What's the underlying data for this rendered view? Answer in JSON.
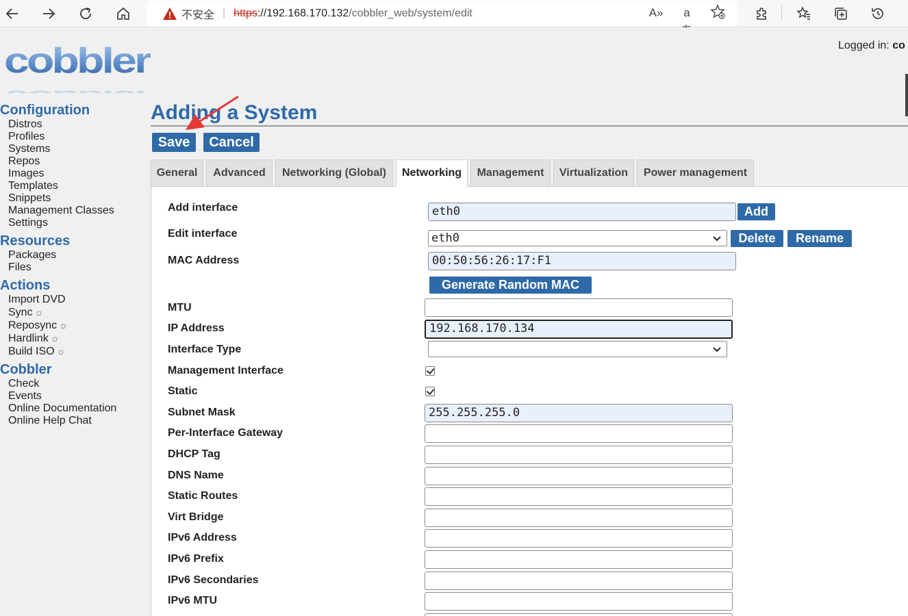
{
  "browser": {
    "security_label": "不安全",
    "url_scheme": "https",
    "url_host": "://192.168.170.132",
    "url_path": "/cobbler_web/system/edit"
  },
  "header": {
    "logged_in_label": "Logged in:",
    "logged_in_user": "co"
  },
  "sidebar": {
    "configuration": {
      "title": "Configuration",
      "items": [
        "Distros",
        "Profiles",
        "Systems",
        "Repos",
        "Images",
        "Templates",
        "Snippets",
        "Management Classes",
        "Settings"
      ]
    },
    "resources": {
      "title": "Resources",
      "items": [
        "Packages",
        "Files"
      ]
    },
    "actions": {
      "title": "Actions",
      "items": [
        "Import DVD",
        "Sync",
        "Reposync",
        "Hardlink",
        "Build ISO"
      ]
    },
    "cobbler": {
      "title": "Cobbler",
      "items": [
        "Check",
        "Events",
        "Online Documentation",
        "Online Help Chat"
      ]
    }
  },
  "main": {
    "title": "Adding a System",
    "save_label": "Save",
    "cancel_label": "Cancel",
    "tabs": [
      "General",
      "Advanced",
      "Networking (Global)",
      "Networking",
      "Management",
      "Virtualization",
      "Power management"
    ],
    "active_tab": "Networking"
  },
  "form": {
    "add_interface": {
      "label": "Add interface",
      "value": "eth0",
      "button": "Add"
    },
    "edit_interface": {
      "label": "Edit interface",
      "value": "eth0",
      "delete": "Delete",
      "rename": "Rename"
    },
    "mac_address": {
      "label": "MAC Address",
      "value": "00:50:56:26:17:F1",
      "button": "Generate Random MAC"
    },
    "mtu": {
      "label": "MTU",
      "value": ""
    },
    "ip_address": {
      "label": "IP Address",
      "value": "192.168.170.134"
    },
    "interface_type": {
      "label": "Interface Type",
      "value": ""
    },
    "management_interface": {
      "label": "Management Interface",
      "checked": true
    },
    "static": {
      "label": "Static",
      "checked": true
    },
    "subnet_mask": {
      "label": "Subnet Mask",
      "value": "255.255.255.0"
    },
    "per_interface_gateway": {
      "label": "Per-Interface Gateway",
      "value": ""
    },
    "dhcp_tag": {
      "label": "DHCP Tag",
      "value": ""
    },
    "dns_name": {
      "label": "DNS Name",
      "value": ""
    },
    "static_routes": {
      "label": "Static Routes",
      "value": ""
    },
    "virt_bridge": {
      "label": "Virt Bridge",
      "value": ""
    },
    "ipv6_address": {
      "label": "IPv6 Address",
      "value": ""
    },
    "ipv6_prefix": {
      "label": "IPv6 Prefix",
      "value": ""
    },
    "ipv6_secondaries": {
      "label": "IPv6 Secondaries",
      "value": ""
    },
    "ipv6_mtu": {
      "label": "IPv6 MTU",
      "value": ""
    }
  }
}
